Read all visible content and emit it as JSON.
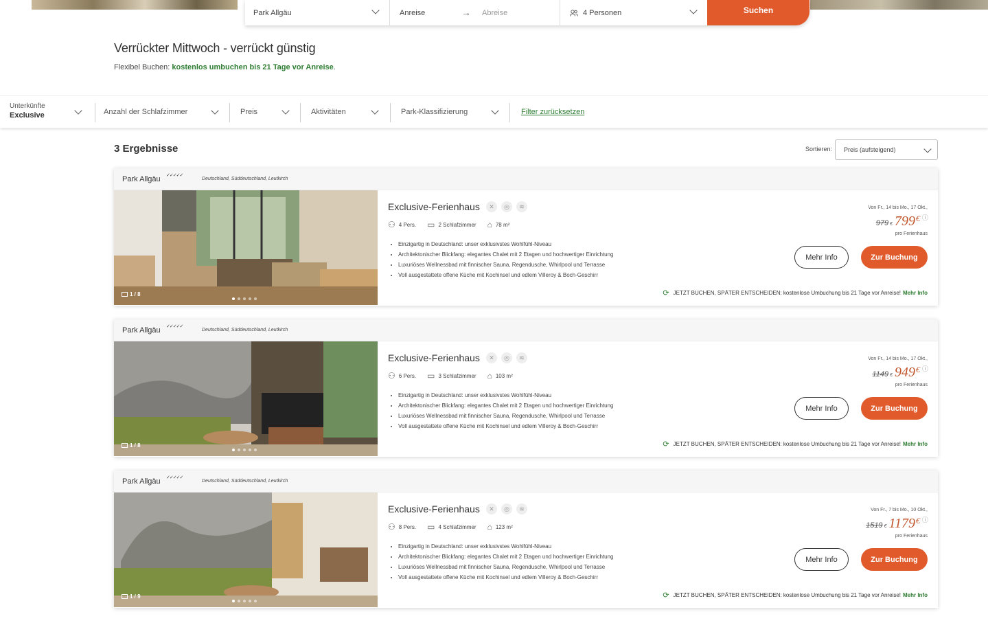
{
  "search": {
    "park": "Park Allgäu",
    "arrival": "Anreise",
    "departure": "Abreise",
    "persons": "4 Personen",
    "search_button": "Suchen"
  },
  "promo": {
    "title": "Verrückter Mittwoch - verrückt günstig",
    "flex_prefix": "Flexibel Buchen: ",
    "flex_highlight": "kostenlos umbuchen bis 21 Tage vor Anreise",
    "flex_suffix": "."
  },
  "filters": {
    "accommodation_label": "Unterkünfte",
    "accommodation_value": "Exclusive",
    "bedrooms": "Anzahl der Schlafzimmer",
    "price": "Preis",
    "activities": "Aktivitäten",
    "classification": "Park-Klassifizierung",
    "reset": "Filter zurücksetzen"
  },
  "results": {
    "count_label": "3 Ergebnisse",
    "sort_label": "Sortieren:",
    "sort_value": "Preis (aufsteigend)"
  },
  "cards": [
    {
      "park": "Park Allgäu",
      "stars": "✓✓✓✓✓",
      "location": "Deutschland,  Süddeutschland,  Leutkirch",
      "img_count": "1 / 8",
      "title": "Exclusive-Ferienhaus",
      "persons": "4 Pers.",
      "bedrooms": "2 Schlafzimmer",
      "area": "78 m²",
      "bullets": [
        "Einzigartig in Deutschland: unser exklusivstes Wohlfühl-Niveau",
        "Architektonischer Blickfang: elegantes Chalet mit 2 Etagen und hochwertiger Einrichtung",
        "Luxuriöses Wellnessbad mit finnischer Sauna, Regendusche, Whirlpool und Terrasse",
        "Voll ausgestattete offene Küche mit Kochinsel und edlem Villeroy & Boch-Geschirr"
      ],
      "date_range": "Von Fr., 14 bis Mo., 17 Okt.,",
      "old_price": "979",
      "new_price": "799",
      "per_unit": "pro Ferienhaus",
      "more_info": "Mehr Info",
      "book": "Zur Buchung",
      "rebook_text": "JETZT BUCHEN, SPÄTER ENTSCHEIDEN: kostenlose Umbuchung bis 21 Tage vor Anreise!",
      "rebook_link": "Mehr Info"
    },
    {
      "park": "Park Allgäu",
      "stars": "✓✓✓✓✓",
      "location": "Deutschland,  Süddeutschland,  Leutkirch",
      "img_count": "1 / 8",
      "title": "Exclusive-Ferienhaus",
      "persons": "6 Pers.",
      "bedrooms": "3 Schlafzimmer",
      "area": "103 m²",
      "bullets": [
        "Einzigartig in Deutschland: unser exklusivstes Wohlfühl-Niveau",
        "Architektonischer Blickfang: elegantes Chalet mit 2 Etagen und hochwertiger Einrichtung",
        "Luxuriöses Wellnessbad mit finnischer Sauna, Regendusche, Whirlpool und Terrasse",
        "Voll ausgestattete offene Küche mit Kochinsel und edlem Villeroy & Boch-Geschirr"
      ],
      "date_range": "Von Fr., 14 bis Mo., 17 Okt.,",
      "old_price": "1149",
      "new_price": "949",
      "per_unit": "pro Ferienhaus",
      "more_info": "Mehr Info",
      "book": "Zur Buchung",
      "rebook_text": "JETZT BUCHEN, SPÄTER ENTSCHEIDEN: kostenlose Umbuchung bis 21 Tage vor Anreise!",
      "rebook_link": "Mehr Info"
    },
    {
      "park": "Park Allgäu",
      "stars": "✓✓✓✓✓",
      "location": "Deutschland,  Süddeutschland,  Leutkirch",
      "img_count": "1 / 9",
      "title": "Exclusive-Ferienhaus",
      "persons": "8 Pers.",
      "bedrooms": "4 Schlafzimmer",
      "area": "123 m²",
      "bullets": [
        "Einzigartig in Deutschland: unser exklusivstes Wohlfühl-Niveau",
        "Architektonischer Blickfang: elegantes Chalet mit 2 Etagen und hochwertiger Einrichtung",
        "Luxuriöses Wellnessbad mit finnischer Sauna, Regendusche, Whirlpool und Terrasse",
        "Voll ausgestattete offene Küche mit Kochinsel und edlem Villeroy & Boch-Geschirr"
      ],
      "date_range": "Von Fr., 7 bis Mo., 10 Okt.,",
      "old_price": "1519",
      "new_price": "1179",
      "per_unit": "pro Ferienhaus",
      "more_info": "Mehr Info",
      "book": "Zur Buchung",
      "rebook_text": "JETZT BUCHEN, SPÄTER ENTSCHEIDEN: kostenlose Umbuchung bis 21 Tage vor Anreise!",
      "rebook_link": "Mehr Info"
    }
  ],
  "colors": {
    "accent": "#e05a2b",
    "price": "#c0532a",
    "green": "#2e7d32"
  }
}
